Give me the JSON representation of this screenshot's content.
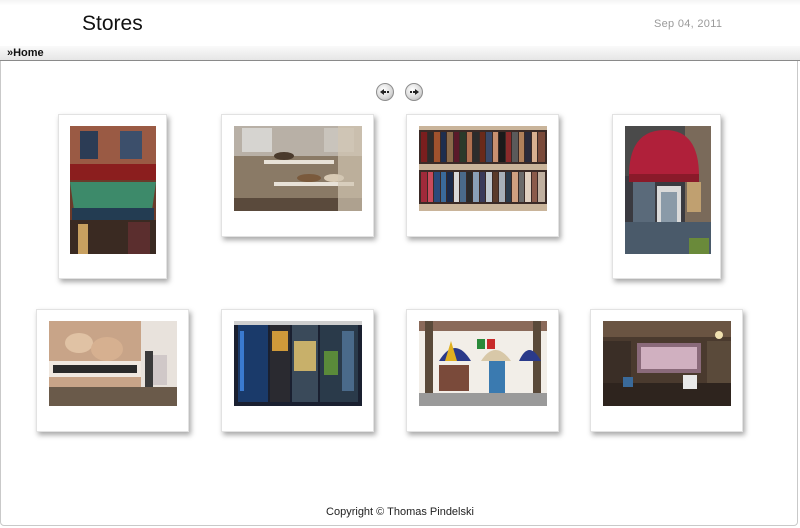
{
  "header": {
    "title": "Stores",
    "date": "Sep 04, 2011"
  },
  "breadcrumb": {
    "home": "»Home"
  },
  "nav": {
    "prev_icon": "prev-arrow-icon",
    "next_icon": "next-arrow-icon"
  },
  "gallery": {
    "thumbnails": [
      {
        "subject": "storefront-awning-photo"
      },
      {
        "subject": "shoe-display-window-photo"
      },
      {
        "subject": "fabric-shelves-photo"
      },
      {
        "subject": "red-awning-doorway-photo"
      },
      {
        "subject": "fashion-billboard-photo"
      },
      {
        "subject": "shop-window-neon-photo"
      },
      {
        "subject": "striped-awnings-building-photo"
      },
      {
        "subject": "shop-interior-photo"
      }
    ]
  },
  "footer": {
    "copyright": "Copyright © Thomas Pindelski"
  }
}
